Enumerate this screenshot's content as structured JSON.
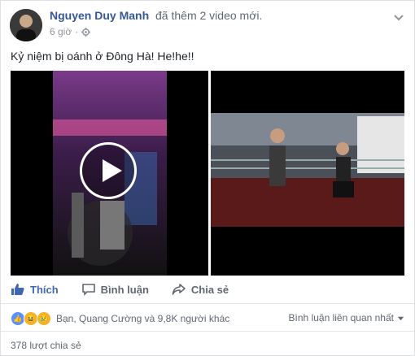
{
  "post": {
    "author": "Nguyen Duy Manh",
    "action": "đã thêm 2 video mới.",
    "time": "6 giờ",
    "privacy_icon": "settings-globe-icon",
    "text": "Kỷ niệm bị oánh ở Đông Hà! He!he!!"
  },
  "actions": {
    "like": "Thích",
    "comment": "Bình luận",
    "share": "Chia sẻ"
  },
  "reactions": {
    "text": "Bạn, Quang Cường và 9,8K người khác",
    "types": [
      "like",
      "haha",
      "sad"
    ]
  },
  "comments": {
    "sort_label": "Bình luận liên quan nhất"
  },
  "shares": {
    "text": "378 lượt chia sẻ"
  },
  "colors": {
    "link": "#365899",
    "like_active": "#4267b2",
    "muted": "#616770"
  }
}
